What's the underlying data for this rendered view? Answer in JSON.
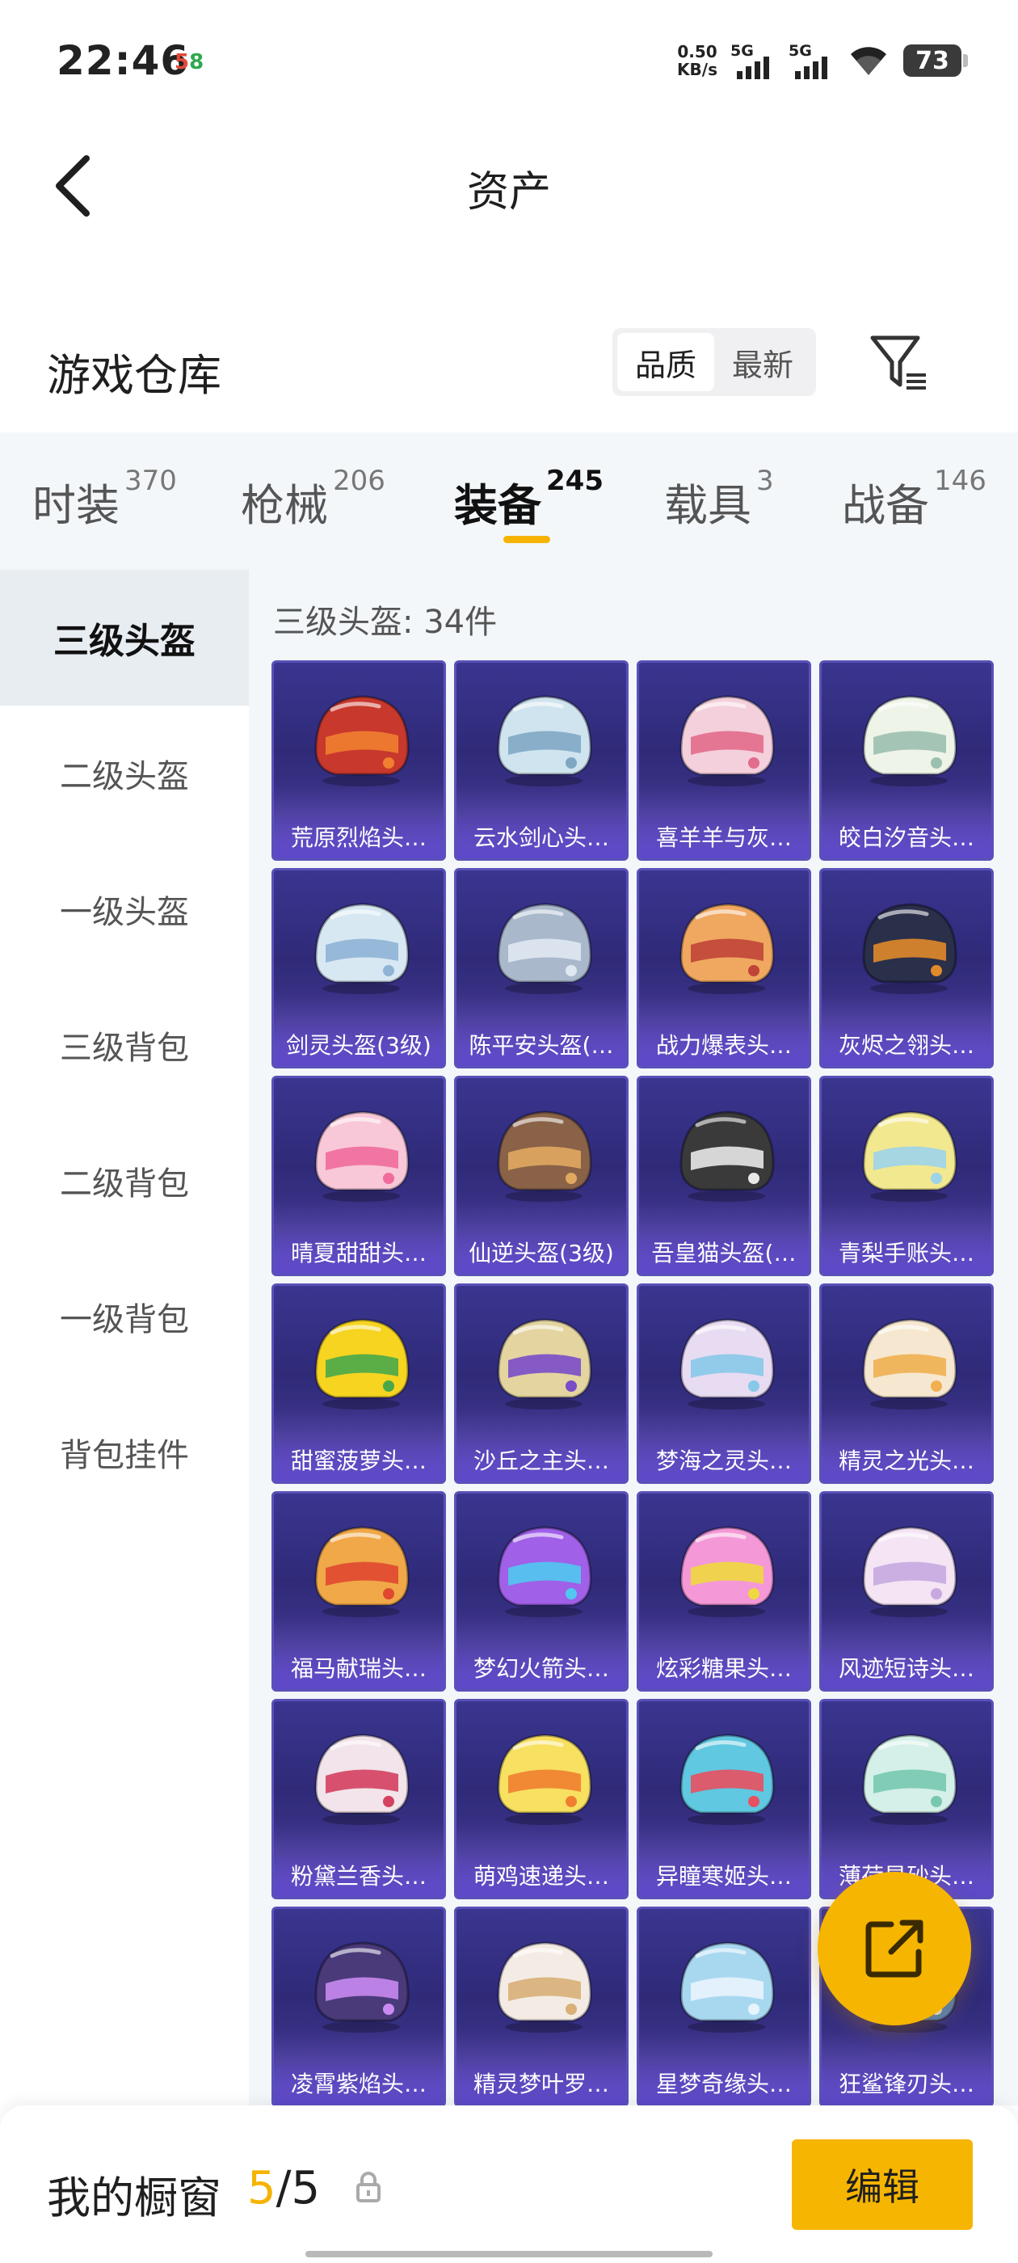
{
  "status_bar": {
    "time": "22:46",
    "badge_a": "5",
    "badge_b": "8",
    "net_speed_value": "0.50",
    "net_speed_unit": "KB/s",
    "signal_1": "5G",
    "signal_2": "5G",
    "battery": "73"
  },
  "header": {
    "title": "资产"
  },
  "warehouse": {
    "title": "游戏仓库",
    "sort_options": [
      "品质",
      "最新"
    ],
    "active_sort": "品质"
  },
  "categories": [
    {
      "name": "时装",
      "count": "370"
    },
    {
      "name": "枪械",
      "count": "206"
    },
    {
      "name": "装备",
      "count": "245"
    },
    {
      "name": "载具",
      "count": "3"
    },
    {
      "name": "战备",
      "count": "146"
    }
  ],
  "active_category": "装备",
  "sidebar": {
    "items": [
      "三级头盔",
      "二级头盔",
      "一级头盔",
      "三级背包",
      "二级背包",
      "一级背包",
      "背包挂件"
    ],
    "active": "三级头盔"
  },
  "content": {
    "subheading": "三级头盔: 34件",
    "items": [
      {
        "label": "荒原烈焰头…",
        "color": "#c8382c",
        "accent": "#f08030"
      },
      {
        "label": "云水剑心头…",
        "color": "#cfe4ee",
        "accent": "#7fa7c4"
      },
      {
        "label": "喜羊羊与灰…",
        "color": "#f4d0dc",
        "accent": "#e26c8c"
      },
      {
        "label": "皎白汐音头…",
        "color": "#eef4e8",
        "accent": "#9bc0b0"
      },
      {
        "label": "剑灵头盔(3级)",
        "color": "#d8e8f2",
        "accent": "#8fb4d6"
      },
      {
        "label": "陈平安头盔(…",
        "color": "#aab8cc",
        "accent": "#dfe8f2"
      },
      {
        "label": "战力爆表头…",
        "color": "#f0a860",
        "accent": "#c04438"
      },
      {
        "label": "灰烬之翎头…",
        "color": "#2a2f4a",
        "accent": "#e08a2a"
      },
      {
        "label": "晴夏甜甜头…",
        "color": "#f8c8d8",
        "accent": "#f06c9c"
      },
      {
        "label": "仙逆头盔(3级)",
        "color": "#8a6248",
        "accent": "#e0a860"
      },
      {
        "label": "吾皇猫头盔(…",
        "color": "#3a3a3a",
        "accent": "#e8e8e8"
      },
      {
        "label": "青梨手账头…",
        "color": "#f2e890",
        "accent": "#9cd4ea"
      },
      {
        "label": "甜蜜菠萝头…",
        "color": "#f6d420",
        "accent": "#4aa84a"
      },
      {
        "label": "沙丘之主头…",
        "color": "#e4d4a0",
        "accent": "#7a4cc8"
      },
      {
        "label": "梦海之灵头…",
        "color": "#e8dcf2",
        "accent": "#88c8e8"
      },
      {
        "label": "精灵之光头…",
        "color": "#f6e8d0",
        "accent": "#f0b050"
      },
      {
        "label": "福马献瑞头…",
        "color": "#f0a848",
        "accent": "#e04830"
      },
      {
        "label": "梦幻火箭头…",
        "color": "#a060e8",
        "accent": "#50c8f0"
      },
      {
        "label": "炫彩糖果头…",
        "color": "#f498d8",
        "accent": "#f0d840"
      },
      {
        "label": "风迹短诗头…",
        "color": "#f4e4f4",
        "accent": "#c8a8e0"
      },
      {
        "label": "粉黛兰香头…",
        "color": "#f2e4ea",
        "accent": "#d44060"
      },
      {
        "label": "萌鸡速递头…",
        "color": "#f8e060",
        "accent": "#f08030"
      },
      {
        "label": "异瞳寒姬头…",
        "color": "#60c8e0",
        "accent": "#e85060"
      },
      {
        "label": "薄荷星砂头…",
        "color": "#d4f0e8",
        "accent": "#78c8b0"
      },
      {
        "label": "凌霄紫焰头…",
        "color": "#4a3a7a",
        "accent": "#c88af0"
      },
      {
        "label": "精灵梦叶罗…",
        "color": "#f4ece4",
        "accent": "#d8b078"
      },
      {
        "label": "星梦奇缘头…",
        "color": "#a8d8f0",
        "accent": "#e8f4fc"
      },
      {
        "label": "狂鲨锋刃头…",
        "color": "#5080c0",
        "accent": "#e8e8e8"
      }
    ]
  },
  "bottom_bar": {
    "label": "我的橱窗",
    "current": "5",
    "separator": "/",
    "total": "5",
    "edit_label": "编辑"
  },
  "colors": {
    "accent": "#f6b500",
    "card_bg": "#2f2a78",
    "panel_bg": "#f4f7fa"
  }
}
